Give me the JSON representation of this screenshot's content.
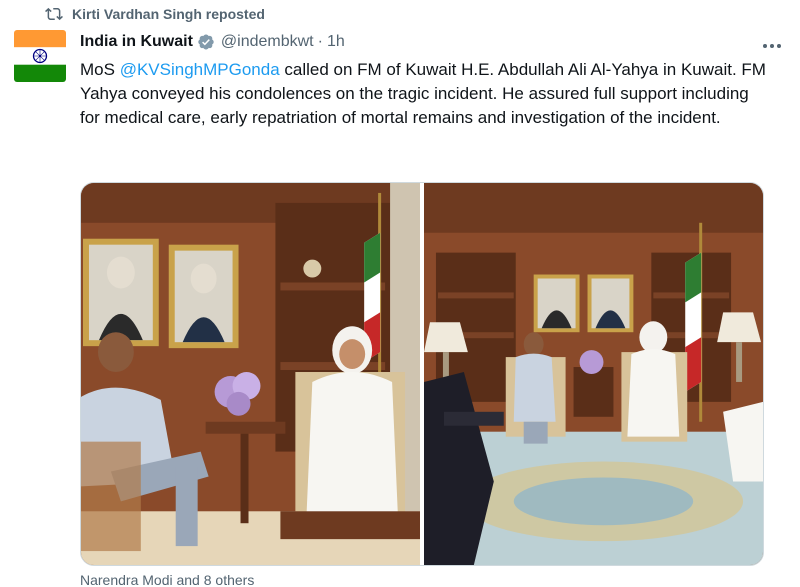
{
  "repost": {
    "icon": "repost-icon",
    "text": "Kirti Vardhan Singh reposted"
  },
  "author": {
    "avatar_icon": "india-flag-icon",
    "display_name": "India in Kuwait",
    "verified_icon": "verified-badge-icon",
    "handle": "@indembkwt",
    "separator": "·",
    "time": "1h"
  },
  "more_icon": "more-options-icon",
  "tweet": {
    "prefix": "MoS ",
    "mention": "@KVSinghMPGonda",
    "body": " called on FM of Kuwait H.E. Abdullah Ali Al-Yahya in Kuwait. FM Yahya conveyed his condolences on the tragic incident. He assured full support including for medical care, early repatriation of mortal remains and investigation of the incident."
  },
  "media": {
    "photos": [
      "photo-meeting-closeup",
      "photo-meeting-wide"
    ]
  },
  "liked_by": "Narendra Modi and 8 others",
  "colors": {
    "text": "#0f1419",
    "muted": "#536471",
    "link": "#1d9bf0",
    "verified_gold": "#829aab"
  }
}
